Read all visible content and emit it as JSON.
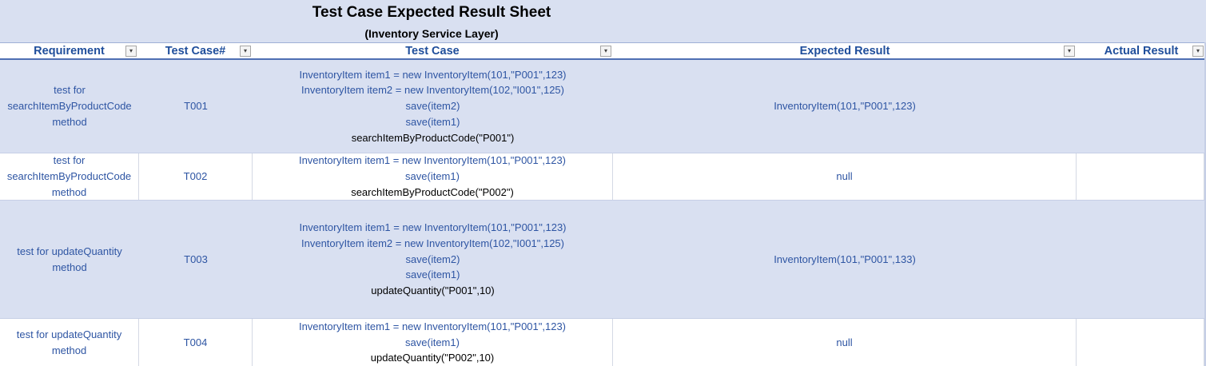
{
  "sheet": {
    "title": "Test Case Expected Result Sheet",
    "subtitle": "(Inventory Service Layer)"
  },
  "columns": {
    "requirement": "Requirement",
    "test_case_no": "Test Case#",
    "test_case": "Test Case",
    "expected_result": "Expected Result",
    "actual_result": "Actual Result",
    "filter_icon": "dropdown-arrow-icon"
  },
  "rows": [
    {
      "requirement": [
        "test for",
        "searchItemByProductCode",
        "method"
      ],
      "id": "T001",
      "steps": [
        "InventoryItem item1 = new InventoryItem(101,\"P001\",123)",
        "InventoryItem item2 = new InventoryItem(102,\"I001\",125)",
        "save(item2)",
        "save(item1)",
        "searchItemByProductCode(\"P001\")"
      ],
      "expected": "InventoryItem(101,\"P001\",123)",
      "actual": ""
    },
    {
      "requirement": [
        "test for",
        "searchItemByProductCode",
        "method"
      ],
      "id": "T002",
      "steps": [
        "InventoryItem item1 = new InventoryItem(101,\"P001\",123)",
        "save(item1)",
        "searchItemByProductCode(\"P002\")"
      ],
      "expected": "null",
      "actual": ""
    },
    {
      "requirement": [
        "test for updateQuantity",
        "method"
      ],
      "id": "T003",
      "steps": [
        "InventoryItem item1 = new InventoryItem(101,\"P001\",123)",
        "InventoryItem item2 = new InventoryItem(102,\"I001\",125)",
        "save(item2)",
        "save(item1)",
        "updateQuantity(\"P001\",10)"
      ],
      "expected": "InventoryItem(101,\"P001\",133)",
      "actual": ""
    },
    {
      "requirement": [
        "test for updateQuantity",
        "method"
      ],
      "id": "T004",
      "steps": [
        "InventoryItem item1 = new InventoryItem(101,\"P001\",123)",
        "save(item1)",
        "updateQuantity(\"P002\",10)"
      ],
      "expected": "null",
      "actual": ""
    }
  ]
}
